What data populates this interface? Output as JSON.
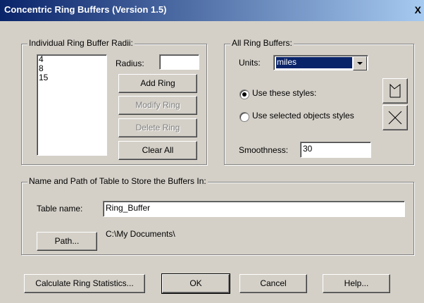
{
  "window": {
    "title": "Concentric Ring Buffers (Version 1.5)",
    "close_label": "X"
  },
  "individual": {
    "legend": "Individual Ring Buffer Radii:",
    "radii": [
      "4",
      "8",
      "15"
    ],
    "radius_label": "Radius:",
    "radius_value": "",
    "add_label": "Add Ring",
    "modify_label": "Modify Ring",
    "delete_label": "Delete Ring",
    "clear_label": "Clear All"
  },
  "all": {
    "legend": "All Ring Buffers:",
    "units_label": "Units:",
    "units_value": "miles",
    "use_these_label": "Use these styles:",
    "use_selected_label": "Use selected objects styles",
    "selected_radio": "use_these",
    "smoothness_label": "Smoothness:",
    "smoothness_value": "30"
  },
  "table": {
    "legend": "Name and Path of Table to Store the Buffers In:",
    "name_label": "Table name:",
    "name_value": "Ring_Buffer",
    "path_button": "Path...",
    "path_value": "C:\\My Documents\\"
  },
  "footer": {
    "calc_label": "Calculate Ring Statistics...",
    "ok_label": "OK",
    "cancel_label": "Cancel",
    "help_label": "Help..."
  },
  "colors": {
    "face": "#d4d0c8",
    "title_start": "#0a246a",
    "title_end": "#a6caf0",
    "selection": "#0a246a"
  }
}
